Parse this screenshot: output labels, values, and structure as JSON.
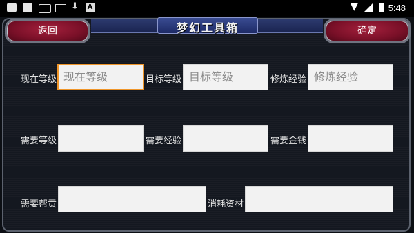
{
  "status_bar": {
    "icons": [
      "app-icon",
      "app-icon",
      "keyboard-icon",
      "mail-icon",
      "download-icon",
      "a-icon",
      "wifi-icon",
      "signal-icon",
      "battery-icon"
    ],
    "a_glyph": "A",
    "time": "5:48"
  },
  "header": {
    "title": "梦幻工具箱",
    "back_label": "返回",
    "confirm_label": "确定"
  },
  "form": {
    "current_level": {
      "label": "现在等级",
      "placeholder": "现在等级",
      "focused": true
    },
    "target_level": {
      "label": "目标等级",
      "placeholder": "目标等级"
    },
    "cultivation_exp": {
      "label": "修炼经验",
      "placeholder": "修炼经验"
    },
    "required_level": {
      "label": "需要等级",
      "value": ""
    },
    "required_exp": {
      "label": "需要经验",
      "value": ""
    },
    "required_money": {
      "label": "需要金钱",
      "value": ""
    },
    "required_contribution": {
      "label": "需要帮贡",
      "value": ""
    },
    "consumed_materials": {
      "label": "消耗资材",
      "value": ""
    }
  },
  "colors": {
    "button": "#7a1028",
    "title_bar": "#2c3a6e",
    "focus": "#f0962a",
    "field_bg": "#f2f2f2"
  }
}
